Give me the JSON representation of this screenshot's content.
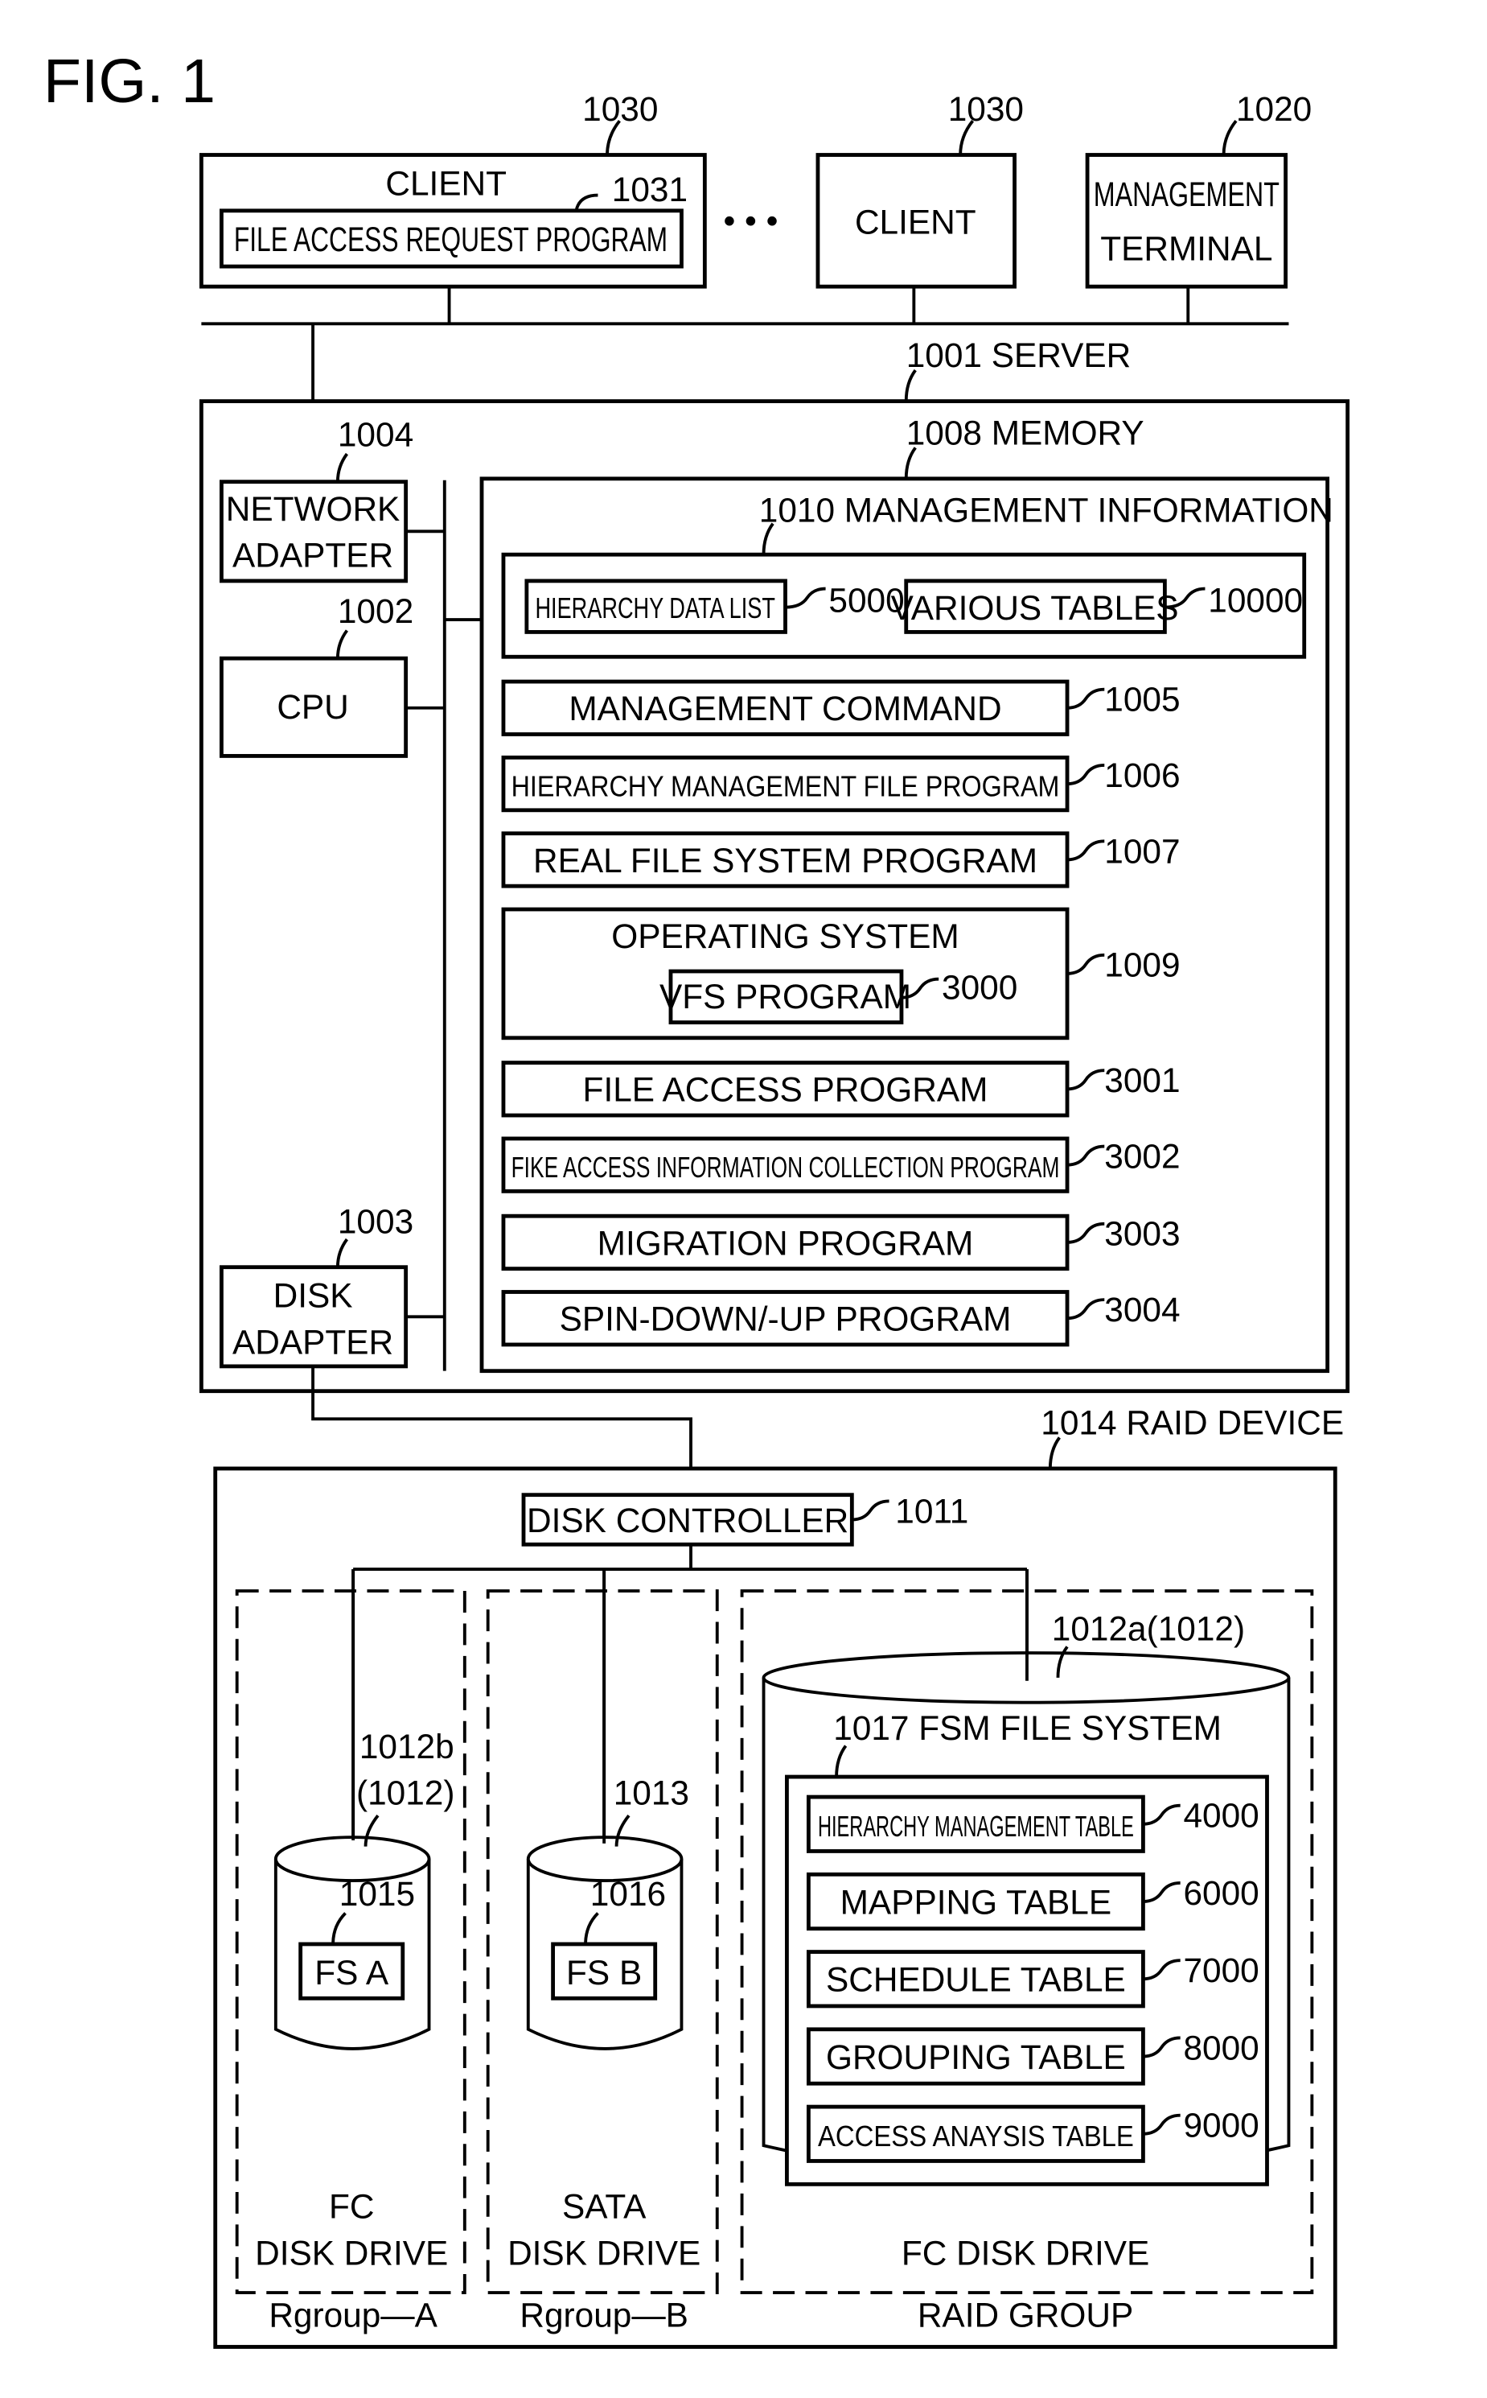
{
  "figure": {
    "title": "FIG. 1",
    "clients": [
      {
        "name": "CLIENT",
        "ref": "1030",
        "program": "FILE ACCESS REQUEST PROGRAM",
        "program_ref": "1031"
      },
      {
        "name": "CLIENT",
        "ref": "1030"
      }
    ],
    "ellipsis": "• • •",
    "management_terminal": {
      "line1": "MANAGEMENT",
      "line2": "TERMINAL",
      "ref": "1020"
    },
    "server": {
      "label": "1001 SERVER",
      "network_adapter": {
        "line1": "NETWORK",
        "line2": "ADAPTER",
        "ref": "1004"
      },
      "cpu": {
        "name": "CPU",
        "ref": "1002"
      },
      "disk_adapter": {
        "line1": "DISK",
        "line2": "ADAPTER",
        "ref": "1003"
      },
      "memory": {
        "label": "1008 MEMORY",
        "management_information": {
          "label": "1010 MANAGEMENT INFORMATION",
          "hierarchy_data_list": {
            "name": "HIERARCHY DATA LIST",
            "ref": "5000"
          },
          "various_tables": {
            "name": "VARIOUS TABLES",
            "ref": "10000"
          }
        },
        "programs": [
          {
            "name": "MANAGEMENT COMMAND",
            "ref": "1005"
          },
          {
            "name": "HIERARCHY MANAGEMENT FILE PROGRAM",
            "ref": "1006"
          },
          {
            "name": "REAL FILE SYSTEM PROGRAM",
            "ref": "1007"
          },
          {
            "name": "OPERATING SYSTEM",
            "ref": "1009",
            "sub": {
              "name": "VFS PROGRAM",
              "ref": "3000"
            }
          },
          {
            "name": "FILE ACCESS PROGRAM",
            "ref": "3001"
          },
          {
            "name": "FIKE ACCESS INFORMATION COLLECTION PROGRAM",
            "ref": "3002"
          },
          {
            "name": "MIGRATION PROGRAM",
            "ref": "3003"
          },
          {
            "name": "SPIN-DOWN/-UP PROGRAM",
            "ref": "3004"
          }
        ]
      }
    },
    "raid_device": {
      "label": "1014 RAID DEVICE",
      "disk_controller": {
        "name": "DISK CONTROLLER",
        "ref": "1011"
      },
      "groups": [
        {
          "drive_line1": "FC",
          "drive_line2": "DISK DRIVE",
          "group": "Rgroup—A",
          "disk_ref1": "1012b",
          "disk_ref2": "(1012)",
          "fs": "FS A",
          "fs_ref": "1015"
        },
        {
          "drive_line1": "SATA",
          "drive_line2": "DISK DRIVE",
          "group": "Rgroup—B",
          "disk_ref1": "1013",
          "fs": "FS B",
          "fs_ref": "1016"
        },
        {
          "drive_line1": "",
          "drive_line2": "FC DISK DRIVE",
          "group": "RAID GROUP",
          "disk_ref1": "1012a(1012)",
          "fs_label": "1017 FSM FILE SYSTEM",
          "tables": [
            {
              "name": "HIERARCHY MANAGEMENT TABLE",
              "ref": "4000"
            },
            {
              "name": "MAPPING TABLE",
              "ref": "6000"
            },
            {
              "name": "SCHEDULE TABLE",
              "ref": "7000"
            },
            {
              "name": "GROUPING TABLE",
              "ref": "8000"
            },
            {
              "name": "ACCESS ANAYSIS TABLE",
              "ref": "9000"
            }
          ]
        }
      ]
    }
  }
}
